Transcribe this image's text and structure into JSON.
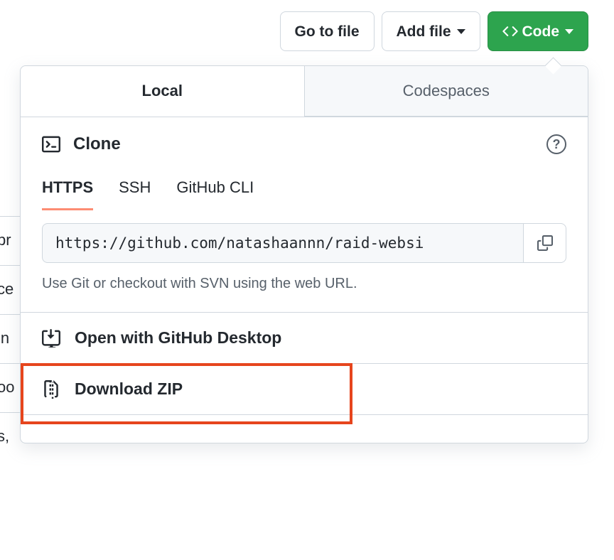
{
  "topbar": {
    "go_to_file": "Go to file",
    "add_file": "Add file",
    "code": "Code"
  },
  "tabs": {
    "local": "Local",
    "codespaces": "Codespaces"
  },
  "clone": {
    "title": "Clone",
    "help": "?",
    "protocols": {
      "https": "HTTPS",
      "ssh": "SSH",
      "gh_cli": "GitHub CLI"
    },
    "url_value": "https://github.com/natashaannn/raid-websi",
    "hint": "Use Git or checkout with SVN using the web URL."
  },
  "actions": {
    "open_desktop": "Open with GitHub Desktop",
    "download_zip": "Download ZIP"
  },
  "left_fragments": {
    "a": "pr",
    "b": "ce",
    "c": "in",
    "d": "oo",
    "e": "s,"
  }
}
